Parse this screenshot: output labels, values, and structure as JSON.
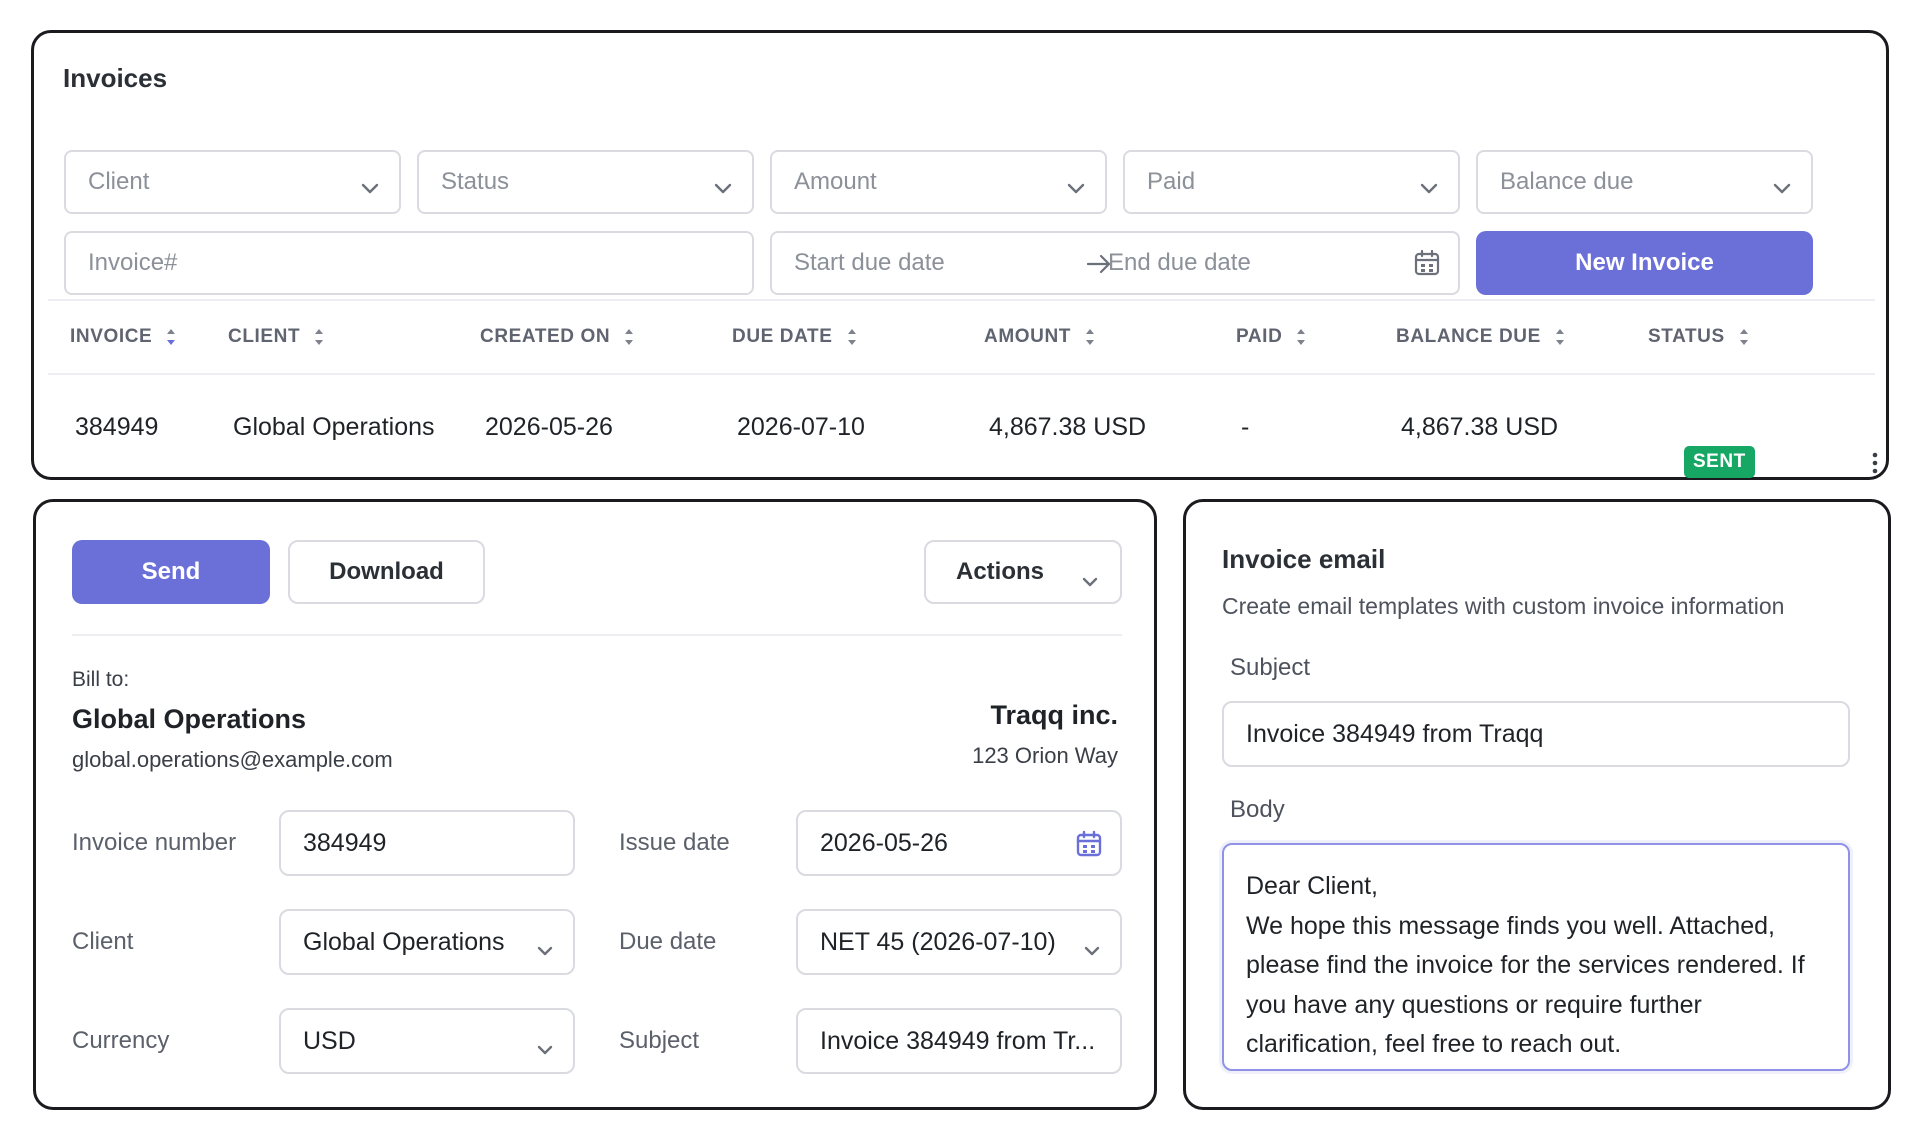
{
  "invoices": {
    "title": "Invoices",
    "filters": {
      "client": "Client",
      "status": "Status",
      "amount": "Amount",
      "paid": "Paid",
      "balance_due": "Balance due",
      "invoice_number": "Invoice#",
      "start_due_date": "Start due date",
      "end_due_date": "End due date"
    },
    "new_invoice_label": "New Invoice",
    "columns": [
      "INVOICE",
      "CLIENT",
      "CREATED ON",
      "DUE DATE",
      "AMOUNT",
      "PAID",
      "BALANCE DUE",
      "STATUS"
    ],
    "rows": [
      {
        "invoice": "384949",
        "client": "Global Operations",
        "created_on": "2026-05-26",
        "due_date": "2026-07-10",
        "amount": "4,867.38 USD",
        "paid": "-",
        "balance_due": "4,867.38 USD",
        "status": "SENT"
      }
    ]
  },
  "detail": {
    "send_label": "Send",
    "download_label": "Download",
    "actions_label": "Actions",
    "bill_to_label": "Bill to:",
    "bill_to_name": "Global Operations",
    "bill_to_email": "global.operations@example.com",
    "company_name": "Traqq inc.",
    "company_address": "123 Orion Way",
    "form": {
      "invoice_number_label": "Invoice number",
      "invoice_number_value": "384949",
      "client_label": "Client",
      "client_value": "Global Operations",
      "currency_label": "Currency",
      "currency_value": "USD",
      "issue_date_label": "Issue date",
      "issue_date_value": "2026-05-26",
      "due_date_label": "Due date",
      "due_date_value": "NET 45 (2026-07-10)",
      "subject_label": "Subject",
      "subject_value": "Invoice 384949 from Tr..."
    }
  },
  "email": {
    "title": "Invoice email",
    "subtitle": "Create email templates with custom invoice information",
    "subject_label": "Subject",
    "subject_value": "Invoice 384949 from Traqq",
    "body_label": "Body",
    "body_lines": [
      "Dear Client,",
      "We hope this message finds you well. Attached,",
      "please find the invoice for the services rendered. If",
      "you have any questions or require further",
      "clarification, feel free to reach out."
    ]
  },
  "colors": {
    "primary": "#6b6fd8",
    "status_sent": "#17a764",
    "border": "#d9dbe0",
    "panel_border": "#1b1b1f"
  },
  "icons": [
    "chevron-down-icon",
    "arrow-right-icon",
    "calendar-icon",
    "sort-icon",
    "kebab-menu-icon"
  ]
}
